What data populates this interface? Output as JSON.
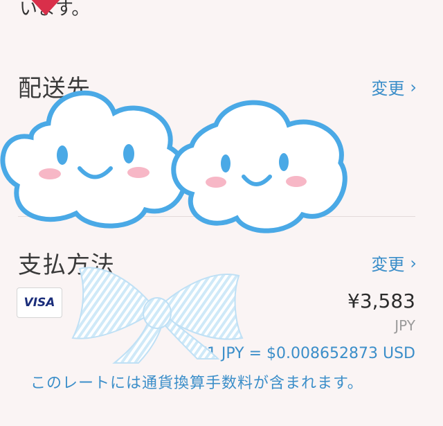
{
  "top": {
    "text": "います。"
  },
  "shipping": {
    "title": "配送先",
    "change_label": "変更"
  },
  "payment": {
    "title": "支払方法",
    "change_label": "変更",
    "card_brand": "VISA",
    "amount": "¥3,583",
    "currency": "JPY",
    "rate": "¥1 JPY = $0.008652873 USD",
    "note": "このレートには通貨換算手数料が含まれます。"
  },
  "icons": {
    "chevron": "chevron-right-icon",
    "stickers": [
      "heart-sticker",
      "cloud-sticker-left",
      "cloud-sticker-right",
      "ribbon-bow-sticker"
    ]
  },
  "colors": {
    "accent": "#3b8ec9",
    "background": "#faf4f4",
    "cloud_outline": "#4aa9e6",
    "cheek": "#f7b7c6"
  }
}
